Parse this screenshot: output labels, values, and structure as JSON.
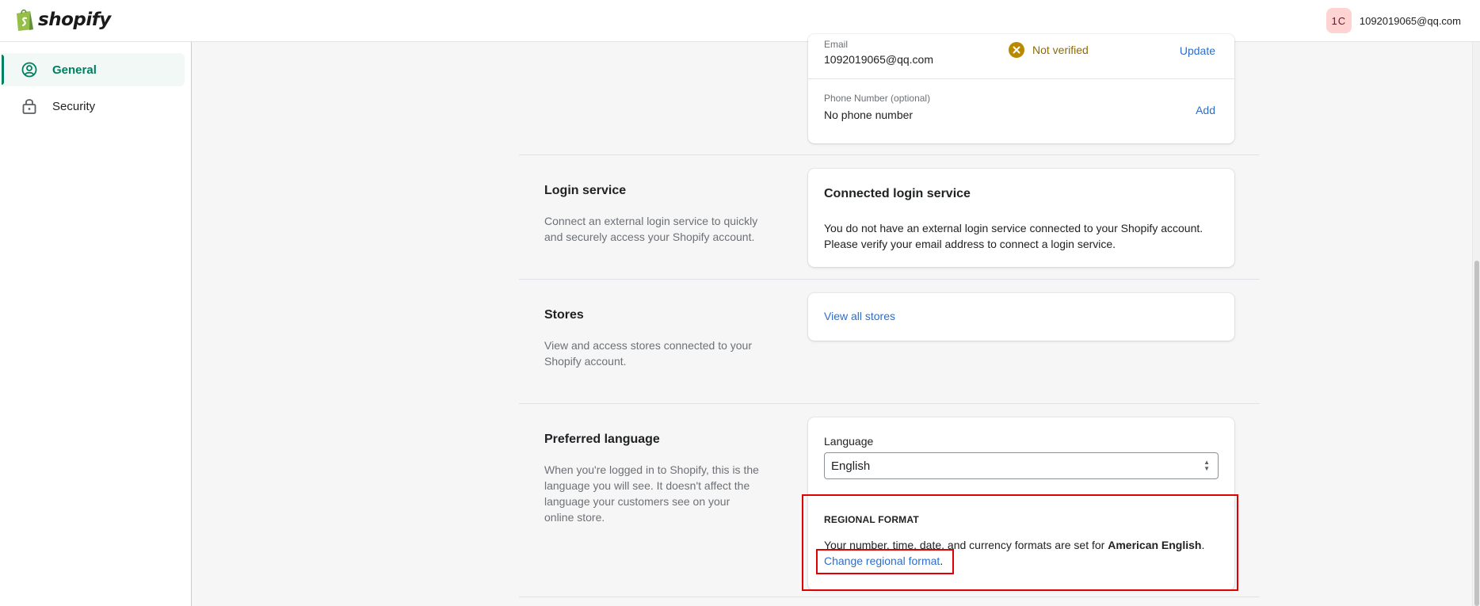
{
  "header": {
    "logo_text": "shopify",
    "avatar_initials": "1C",
    "user_email": "1092019065@qq.com"
  },
  "sidebar": {
    "items": [
      {
        "label": "General",
        "icon": "user-circle-icon",
        "active": true
      },
      {
        "label": "Security",
        "icon": "lock-icon",
        "active": false
      }
    ]
  },
  "contact": {
    "email_label": "Email",
    "email_value": "1092019065@qq.com",
    "email_status": "Not verified",
    "email_action": "Update",
    "phone_label": "Phone Number (optional)",
    "phone_value": "No phone number",
    "phone_action": "Add"
  },
  "login_service": {
    "title": "Login service",
    "description": "Connect an external login service to quickly and securely access your Shopify account.",
    "card_title": "Connected login service",
    "card_text": "You do not have an external login service connected to your Shopify account. Please verify your email address to connect a login service."
  },
  "stores": {
    "title": "Stores",
    "description": "View and access stores connected to your Shopify account.",
    "link": "View all stores"
  },
  "preferred_language": {
    "title": "Preferred language",
    "description": "When you're logged in to Shopify, this is the language you will see. It doesn't affect the language your customers see on your online store.",
    "language_label": "Language",
    "language_value": "English",
    "regional_heading": "REGIONAL FORMAT",
    "regional_text_prefix": "Your number, time, date, and currency formats are set for ",
    "regional_text_bold": "American English",
    "regional_text_suffix": ".",
    "regional_link": "Change regional format",
    "regional_link_suffix": "."
  },
  "colors": {
    "accent_green": "#008060",
    "link_blue": "#2c6ecb",
    "warning": "#b98900",
    "highlight_red": "#e00000"
  }
}
